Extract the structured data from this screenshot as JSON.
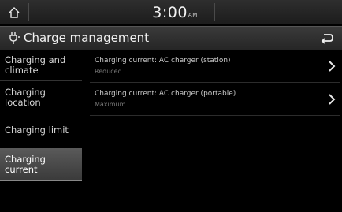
{
  "status_bar": {
    "time": "3:00",
    "ampm": "AM"
  },
  "header": {
    "title": "Charge management"
  },
  "sidebar": {
    "items": [
      {
        "label_line1": "Charging and",
        "label_line2": "climate"
      },
      {
        "label_line1": "Charging",
        "label_line2": "location"
      },
      {
        "label_line1": "Charging limit",
        "label_line2": ""
      },
      {
        "label_line1": "Charging",
        "label_line2": "current"
      }
    ],
    "active_index": 3
  },
  "main": {
    "rows": [
      {
        "title": "Charging current: AC charger (station)",
        "value": "Reduced"
      },
      {
        "title": "Charging current: AC charger (portable)",
        "value": "Maximum"
      }
    ]
  }
}
